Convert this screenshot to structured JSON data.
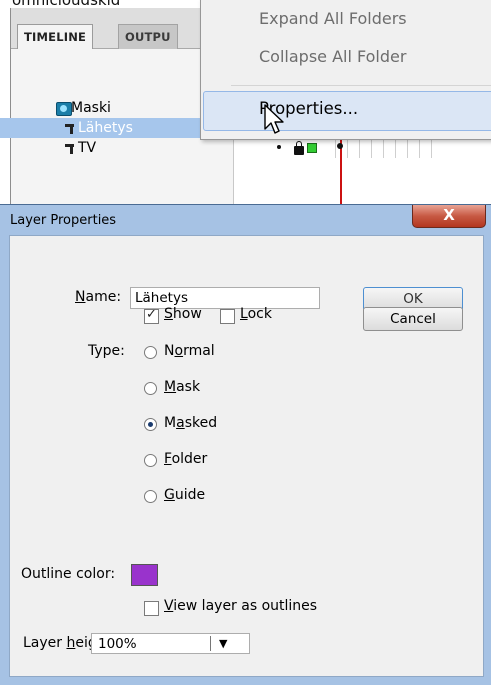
{
  "top_cropped_text": "omnicloudskid",
  "timeline": {
    "tabs": [
      {
        "label": "TIMELINE",
        "active": true
      },
      {
        "label": "OUTPU",
        "active": false
      }
    ],
    "layers": [
      {
        "name": "Maski",
        "icon": "mask-layer-icon",
        "selected": false
      },
      {
        "name": "Lähetys",
        "icon": "masked-layer-icon",
        "selected": true
      },
      {
        "name": "TV",
        "icon": "masked-layer-icon",
        "selected": false
      }
    ],
    "playhead_color": "#cc1111",
    "selection_color": "#a6c6ec"
  },
  "context_menu": {
    "items": [
      {
        "label": "Expand All Folders",
        "enabled": false
      },
      {
        "label": "Collapse All Folder",
        "enabled": false
      },
      {
        "label": "Properties...",
        "enabled": true,
        "highlighted": true
      }
    ]
  },
  "dialog": {
    "title": "Layer Properties",
    "close_label": "X",
    "name": {
      "label_mnemonic": "N",
      "label_rest": "ame:",
      "value": "Lähetys"
    },
    "ok_label": "OK",
    "cancel_label": "Cancel",
    "show": {
      "mnemonic": "S",
      "rest": "how",
      "checked": true
    },
    "lock": {
      "mnemonic": "L",
      "rest": "ock",
      "checked": false
    },
    "type_label": "Type:",
    "types": [
      {
        "pre": "N",
        "mnemonic": "o",
        "rest": "rmal",
        "checked": false
      },
      {
        "pre": "",
        "mnemonic": "M",
        "rest": "ask",
        "checked": false
      },
      {
        "pre": "M",
        "mnemonic": "a",
        "rest": "sked",
        "checked": true
      },
      {
        "pre": "",
        "mnemonic": "F",
        "rest": "older",
        "checked": false
      },
      {
        "pre": "",
        "mnemonic": "G",
        "rest": "uide",
        "checked": false
      }
    ],
    "outline_color": {
      "label": "Outline color:",
      "value": "#9933cc"
    },
    "view_outlines": {
      "mnemonic": "V",
      "rest": "iew layer as outlines",
      "checked": false
    },
    "layer_height": {
      "label_pre": "Layer ",
      "mnemonic": "h",
      "label_rest": "eight:",
      "value": "100%"
    }
  }
}
